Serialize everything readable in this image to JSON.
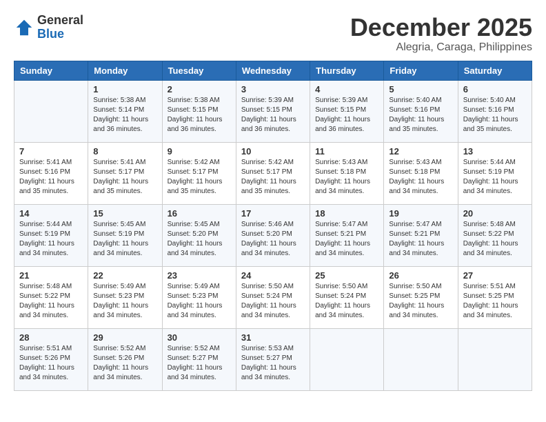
{
  "logo": {
    "general": "General",
    "blue": "Blue"
  },
  "header": {
    "month": "December 2025",
    "location": "Alegria, Caraga, Philippines"
  },
  "weekdays": [
    "Sunday",
    "Monday",
    "Tuesday",
    "Wednesday",
    "Thursday",
    "Friday",
    "Saturday"
  ],
  "weeks": [
    [
      {
        "day": "",
        "info": ""
      },
      {
        "day": "1",
        "info": "Sunrise: 5:38 AM\nSunset: 5:14 PM\nDaylight: 11 hours\nand 36 minutes."
      },
      {
        "day": "2",
        "info": "Sunrise: 5:38 AM\nSunset: 5:15 PM\nDaylight: 11 hours\nand 36 minutes."
      },
      {
        "day": "3",
        "info": "Sunrise: 5:39 AM\nSunset: 5:15 PM\nDaylight: 11 hours\nand 36 minutes."
      },
      {
        "day": "4",
        "info": "Sunrise: 5:39 AM\nSunset: 5:15 PM\nDaylight: 11 hours\nand 36 minutes."
      },
      {
        "day": "5",
        "info": "Sunrise: 5:40 AM\nSunset: 5:16 PM\nDaylight: 11 hours\nand 35 minutes."
      },
      {
        "day": "6",
        "info": "Sunrise: 5:40 AM\nSunset: 5:16 PM\nDaylight: 11 hours\nand 35 minutes."
      }
    ],
    [
      {
        "day": "7",
        "info": "Sunrise: 5:41 AM\nSunset: 5:16 PM\nDaylight: 11 hours\nand 35 minutes."
      },
      {
        "day": "8",
        "info": "Sunrise: 5:41 AM\nSunset: 5:17 PM\nDaylight: 11 hours\nand 35 minutes."
      },
      {
        "day": "9",
        "info": "Sunrise: 5:42 AM\nSunset: 5:17 PM\nDaylight: 11 hours\nand 35 minutes."
      },
      {
        "day": "10",
        "info": "Sunrise: 5:42 AM\nSunset: 5:17 PM\nDaylight: 11 hours\nand 35 minutes."
      },
      {
        "day": "11",
        "info": "Sunrise: 5:43 AM\nSunset: 5:18 PM\nDaylight: 11 hours\nand 34 minutes."
      },
      {
        "day": "12",
        "info": "Sunrise: 5:43 AM\nSunset: 5:18 PM\nDaylight: 11 hours\nand 34 minutes."
      },
      {
        "day": "13",
        "info": "Sunrise: 5:44 AM\nSunset: 5:19 PM\nDaylight: 11 hours\nand 34 minutes."
      }
    ],
    [
      {
        "day": "14",
        "info": "Sunrise: 5:44 AM\nSunset: 5:19 PM\nDaylight: 11 hours\nand 34 minutes."
      },
      {
        "day": "15",
        "info": "Sunrise: 5:45 AM\nSunset: 5:19 PM\nDaylight: 11 hours\nand 34 minutes."
      },
      {
        "day": "16",
        "info": "Sunrise: 5:45 AM\nSunset: 5:20 PM\nDaylight: 11 hours\nand 34 minutes."
      },
      {
        "day": "17",
        "info": "Sunrise: 5:46 AM\nSunset: 5:20 PM\nDaylight: 11 hours\nand 34 minutes."
      },
      {
        "day": "18",
        "info": "Sunrise: 5:47 AM\nSunset: 5:21 PM\nDaylight: 11 hours\nand 34 minutes."
      },
      {
        "day": "19",
        "info": "Sunrise: 5:47 AM\nSunset: 5:21 PM\nDaylight: 11 hours\nand 34 minutes."
      },
      {
        "day": "20",
        "info": "Sunrise: 5:48 AM\nSunset: 5:22 PM\nDaylight: 11 hours\nand 34 minutes."
      }
    ],
    [
      {
        "day": "21",
        "info": "Sunrise: 5:48 AM\nSunset: 5:22 PM\nDaylight: 11 hours\nand 34 minutes."
      },
      {
        "day": "22",
        "info": "Sunrise: 5:49 AM\nSunset: 5:23 PM\nDaylight: 11 hours\nand 34 minutes."
      },
      {
        "day": "23",
        "info": "Sunrise: 5:49 AM\nSunset: 5:23 PM\nDaylight: 11 hours\nand 34 minutes."
      },
      {
        "day": "24",
        "info": "Sunrise: 5:50 AM\nSunset: 5:24 PM\nDaylight: 11 hours\nand 34 minutes."
      },
      {
        "day": "25",
        "info": "Sunrise: 5:50 AM\nSunset: 5:24 PM\nDaylight: 11 hours\nand 34 minutes."
      },
      {
        "day": "26",
        "info": "Sunrise: 5:50 AM\nSunset: 5:25 PM\nDaylight: 11 hours\nand 34 minutes."
      },
      {
        "day": "27",
        "info": "Sunrise: 5:51 AM\nSunset: 5:25 PM\nDaylight: 11 hours\nand 34 minutes."
      }
    ],
    [
      {
        "day": "28",
        "info": "Sunrise: 5:51 AM\nSunset: 5:26 PM\nDaylight: 11 hours\nand 34 minutes."
      },
      {
        "day": "29",
        "info": "Sunrise: 5:52 AM\nSunset: 5:26 PM\nDaylight: 11 hours\nand 34 minutes."
      },
      {
        "day": "30",
        "info": "Sunrise: 5:52 AM\nSunset: 5:27 PM\nDaylight: 11 hours\nand 34 minutes."
      },
      {
        "day": "31",
        "info": "Sunrise: 5:53 AM\nSunset: 5:27 PM\nDaylight: 11 hours\nand 34 minutes."
      },
      {
        "day": "",
        "info": ""
      },
      {
        "day": "",
        "info": ""
      },
      {
        "day": "",
        "info": ""
      }
    ]
  ]
}
